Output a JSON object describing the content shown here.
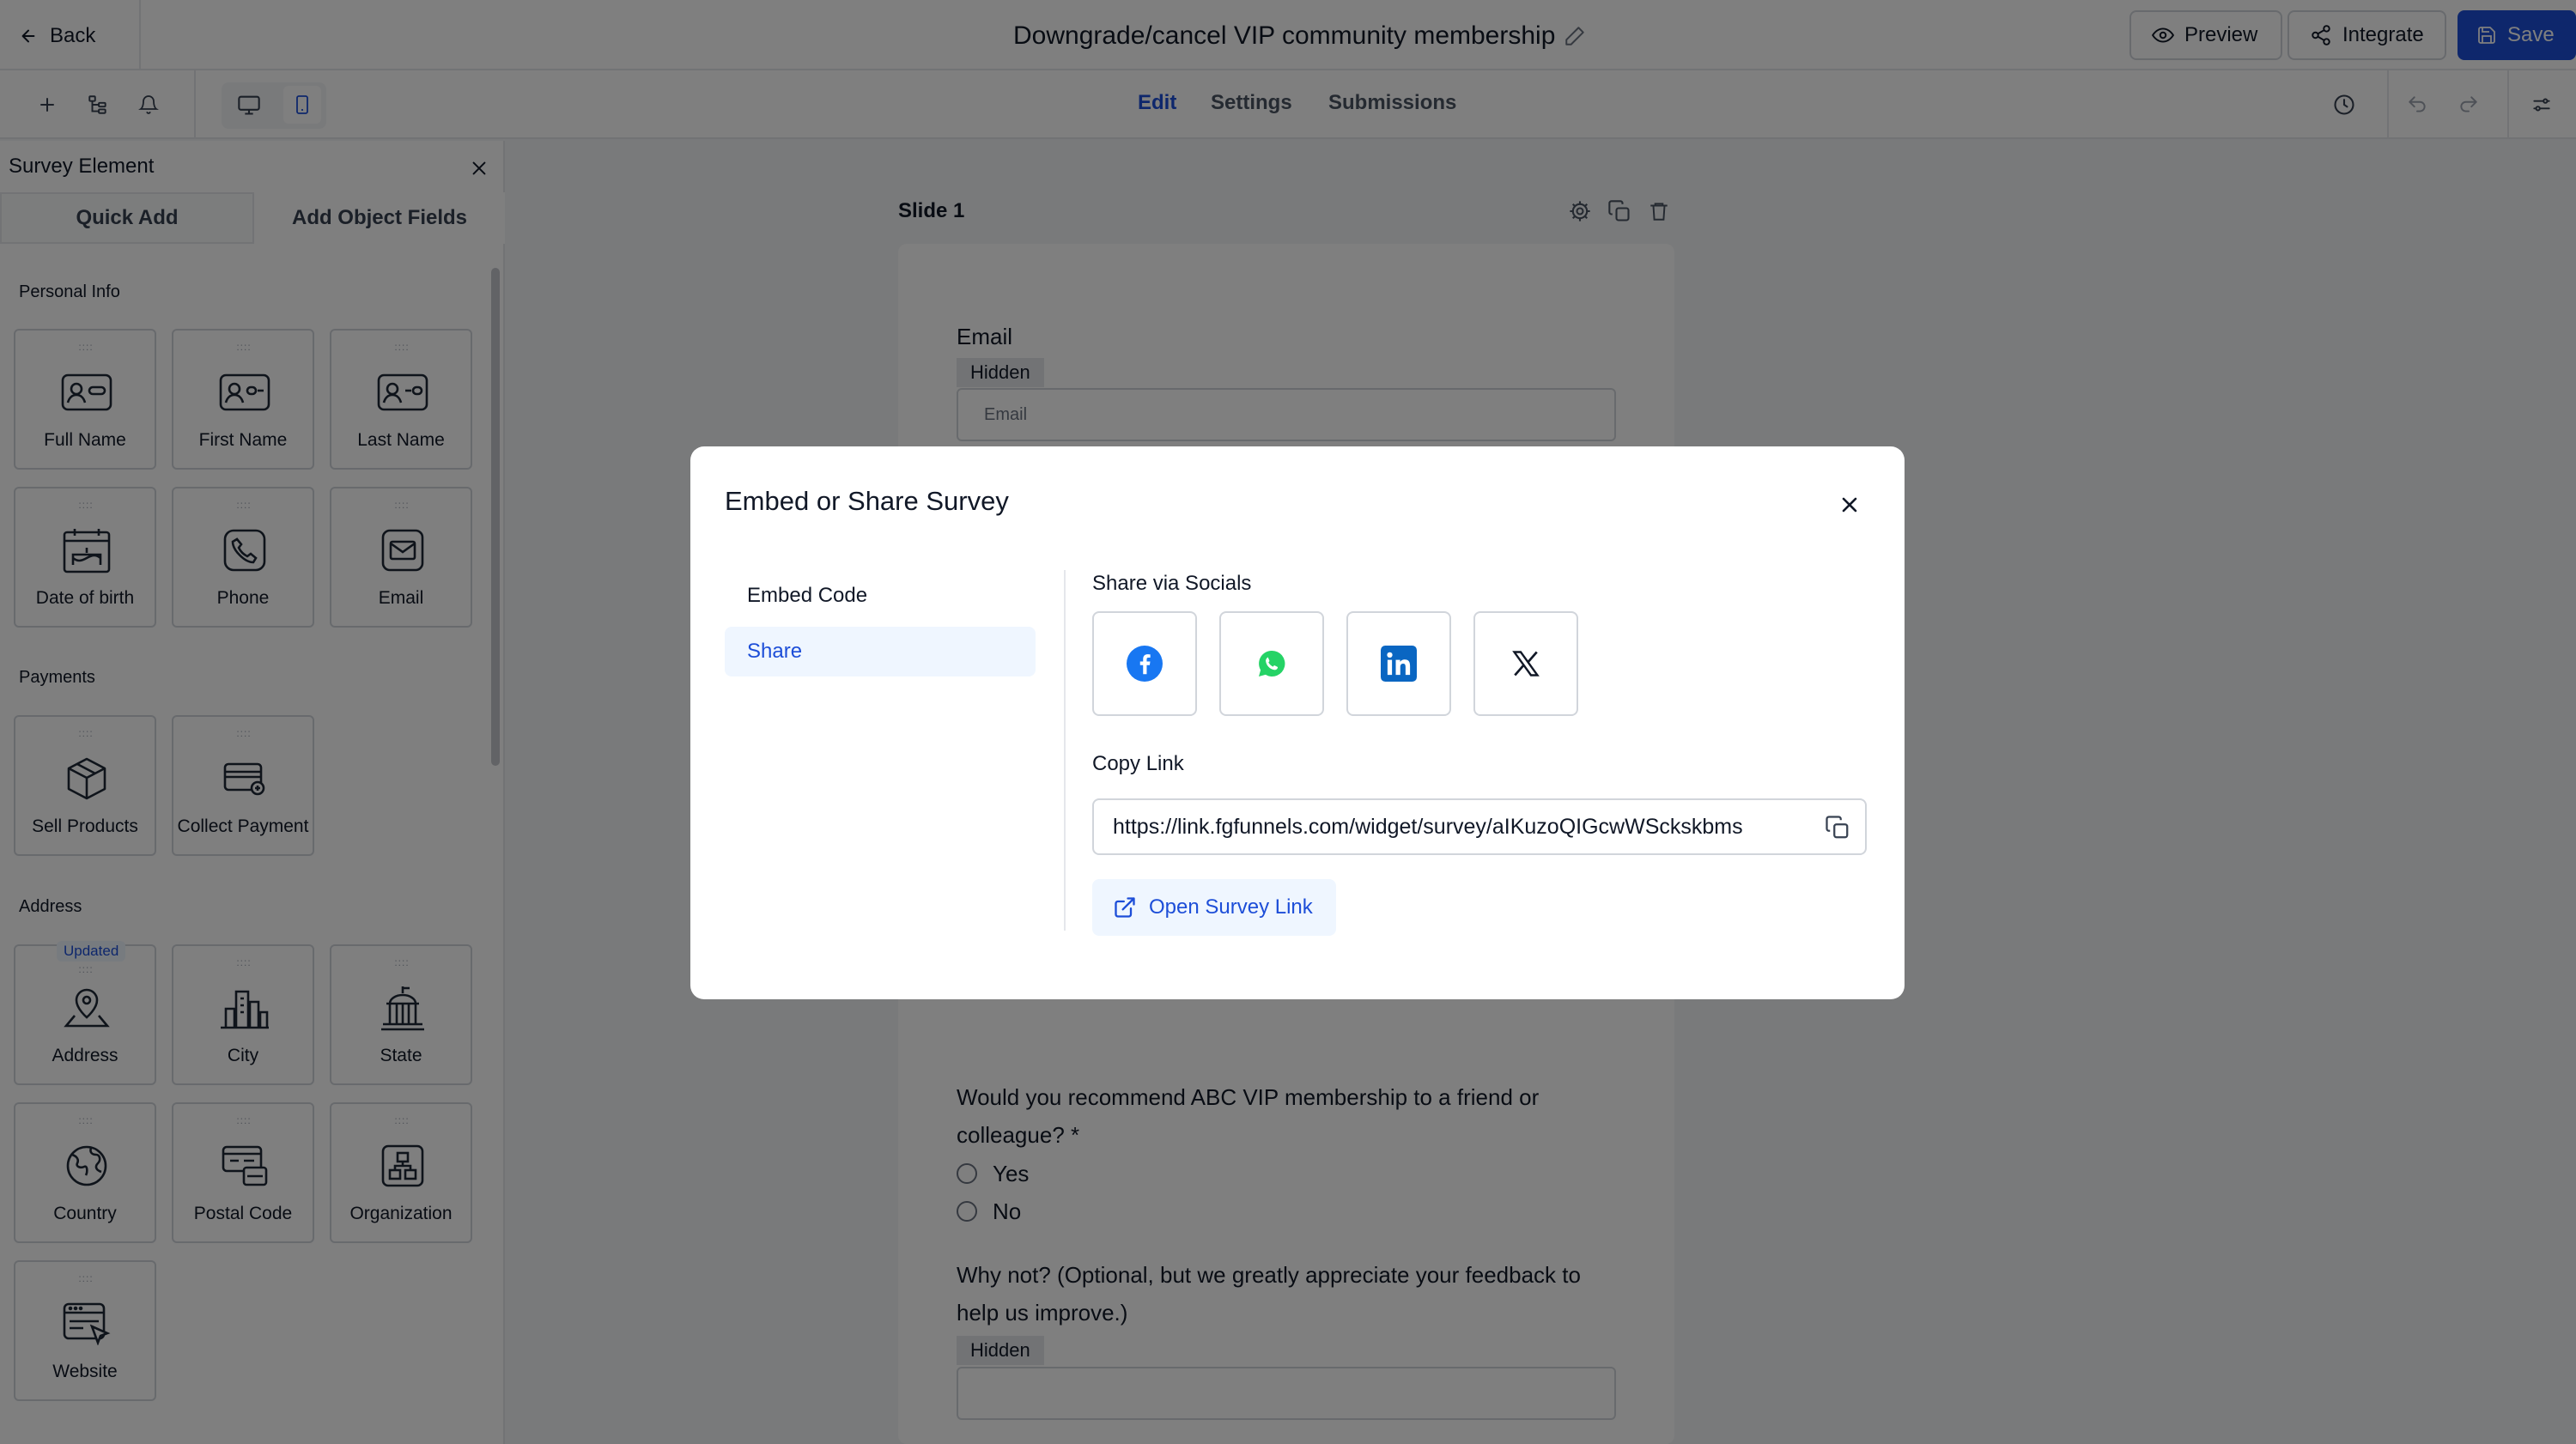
{
  "header": {
    "back_label": "Back",
    "title": "Downgrade/cancel VIP community membership",
    "preview_label": "Preview",
    "integrate_label": "Integrate",
    "save_label": "Save"
  },
  "nav_tabs": [
    {
      "label": "Edit",
      "active": true
    },
    {
      "label": "Settings",
      "active": false
    },
    {
      "label": "Submissions",
      "active": false
    }
  ],
  "sidebar": {
    "title": "Survey Element",
    "tabs": [
      {
        "label": "Quick Add"
      },
      {
        "label": "Add Object Fields",
        "active": true
      }
    ],
    "sections": [
      {
        "title": "Personal Info",
        "items": [
          {
            "label": "Full Name",
            "icon": "id-card-icon"
          },
          {
            "label": "First Name",
            "icon": "id-card-icon"
          },
          {
            "label": "Last Name",
            "icon": "id-card-icon"
          },
          {
            "label": "Date of birth",
            "icon": "calendar-cake-icon"
          },
          {
            "label": "Phone",
            "icon": "phone-icon"
          },
          {
            "label": "Email",
            "icon": "email-icon"
          }
        ]
      },
      {
        "title": "Payments",
        "items": [
          {
            "label": "Sell Products",
            "icon": "box-icon"
          },
          {
            "label": "Collect Payment",
            "icon": "credit-card-icon"
          }
        ]
      },
      {
        "title": "Address",
        "items": [
          {
            "label": "Address",
            "icon": "map-pin-icon",
            "badge": "Updated"
          },
          {
            "label": "City",
            "icon": "city-icon"
          },
          {
            "label": "State",
            "icon": "capitol-icon"
          },
          {
            "label": "Country",
            "icon": "globe-icon"
          },
          {
            "label": "Postal Code",
            "icon": "mailbox-icon"
          },
          {
            "label": "Organization",
            "icon": "org-chart-icon"
          },
          {
            "label": "Website",
            "icon": "browser-cursor-icon"
          }
        ]
      }
    ]
  },
  "slide": {
    "label": "Slide 1",
    "email_label": "Email",
    "hidden_tag": "Hidden",
    "email_placeholder": "Email",
    "question": "Would you recommend ABC VIP membership to a friend or colleague? *",
    "question_line1": "Would you recommend ABC VIP membership to a friend or",
    "question_line2": "colleague? *",
    "options": [
      "Yes",
      "No"
    ],
    "why_line1": "Why not? (Optional, but we greatly appreciate your feedback to",
    "why_line2": "help us improve.)",
    "why_hidden_tag": "Hidden"
  },
  "modal": {
    "title": "Embed or Share Survey",
    "nav": [
      {
        "label": "Embed Code",
        "active": false
      },
      {
        "label": "Share",
        "active": true
      }
    ],
    "share_via_socials": "Share via Socials",
    "socials": [
      "facebook-icon",
      "whatsapp-icon",
      "linkedin-icon",
      "x-icon"
    ],
    "copy_link_title": "Copy Link",
    "link": "https://link.fgfunnels.com/widget/survey/aIKuzoQIGcwWSckskbms",
    "open_link_label": "Open Survey Link"
  },
  "colors": {
    "accent": "#1d4ed8",
    "accent_light": "#eff6ff",
    "facebook": "#1877f2",
    "whatsapp": "#25d366",
    "linkedin": "#0a66c2"
  }
}
